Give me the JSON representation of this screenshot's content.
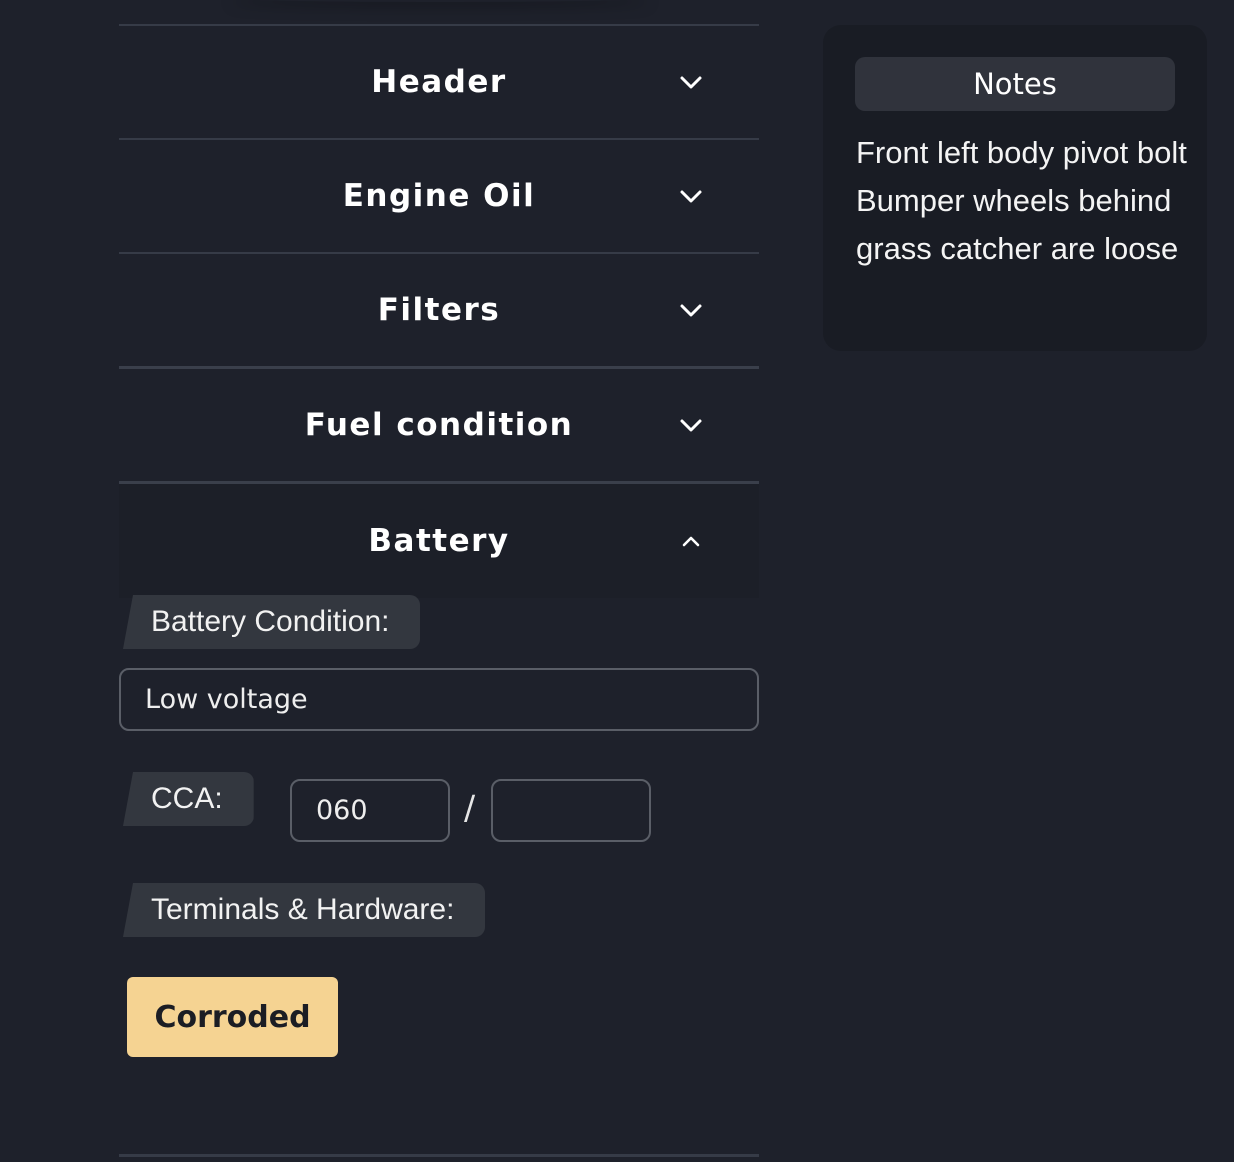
{
  "accordion": {
    "sections": [
      {
        "label": "Header",
        "state": "collapsed",
        "icon": "chevron-down-icon"
      },
      {
        "label": "Engine Oil",
        "state": "collapsed",
        "icon": "chevron-down-icon"
      },
      {
        "label": "Filters",
        "state": "collapsed",
        "icon": "chevron-down-icon"
      },
      {
        "label": "Fuel condition",
        "state": "collapsed",
        "icon": "chevron-down-icon"
      },
      {
        "label": "Battery",
        "state": "expanded",
        "icon": "chevron-up-icon"
      }
    ]
  },
  "battery": {
    "condition_label": "Battery Condition:",
    "condition_value": "Low voltage",
    "cca_label": "CCA:",
    "cca_value": "060",
    "cca_rated_value": "",
    "cca_separator": "/",
    "terminals_label": "Terminals & Hardware:",
    "terminals_option": "Corroded"
  },
  "notes": {
    "title": "Notes",
    "text": "Front left body pivot bolt Bumper wheels behind grass catcher are loose"
  },
  "colors": {
    "background": "#1e212b",
    "card": "#191c24",
    "label_bg": "#33373f",
    "accent_button": "#f5d392"
  }
}
